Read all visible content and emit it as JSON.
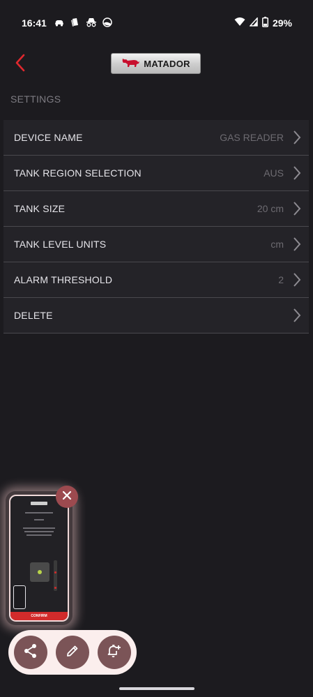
{
  "status_bar": {
    "time": "16:41",
    "battery": "29%",
    "left_icons": [
      "car-icon",
      "gallery-icon",
      "incognito-icon",
      "globe-icon"
    ],
    "right_icons": [
      "wifi-icon",
      "signal-icon",
      "battery-icon"
    ]
  },
  "header": {
    "logo_text": "MATADOR",
    "back_icon": "chevron-left-icon"
  },
  "settings": {
    "title": "SETTINGS",
    "rows": [
      {
        "label": "DEVICE NAME",
        "value": "GAS READER"
      },
      {
        "label": "TANK REGION SELECTION",
        "value": "AUS"
      },
      {
        "label": "TANK SIZE",
        "value": "20 cm"
      },
      {
        "label": "TANK LEVEL UNITS",
        "value": "cm"
      },
      {
        "label": "ALARM THRESHOLD",
        "value": "2"
      },
      {
        "label": "DELETE",
        "value": ""
      }
    ]
  },
  "screenshot_preview": {
    "bottom_label": "CONFIRM"
  },
  "actions": {
    "share": "share-icon",
    "edit": "edit-icon",
    "reminder": "add-reminder-icon"
  },
  "colors": {
    "background": "#1c1b1f",
    "row_background": "#242328",
    "accent": "#d22b2b",
    "action_button": "#7b5457",
    "pill": "#fbeeed"
  }
}
